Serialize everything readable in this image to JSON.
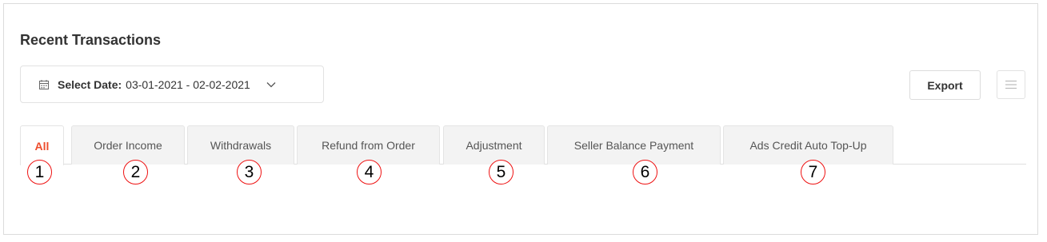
{
  "title": "Recent Transactions",
  "date_picker": {
    "label": "Select Date:",
    "value": "03-01-2021 - 02-02-2021",
    "icon": "calendar-icon",
    "dropdown_icon": "chevron-down-icon"
  },
  "toolbar": {
    "export_label": "Export",
    "menu_icon": "menu-icon"
  },
  "tabs": [
    {
      "label": "All",
      "active": true,
      "marker": "1"
    },
    {
      "label": "Order Income",
      "active": false,
      "marker": "2"
    },
    {
      "label": "Withdrawals",
      "active": false,
      "marker": "3"
    },
    {
      "label": "Refund from Order",
      "active": false,
      "marker": "4"
    },
    {
      "label": "Adjustment",
      "active": false,
      "marker": "5"
    },
    {
      "label": "Seller Balance Payment",
      "active": false,
      "marker": "6"
    },
    {
      "label": "Ads Credit Auto Top-Up",
      "active": false,
      "marker": "7"
    }
  ],
  "colors": {
    "accent": "#ee4d2d",
    "marker_border": "#ee1111",
    "tab_inactive_bg": "#f3f3f3",
    "border": "#dcdcdc"
  }
}
